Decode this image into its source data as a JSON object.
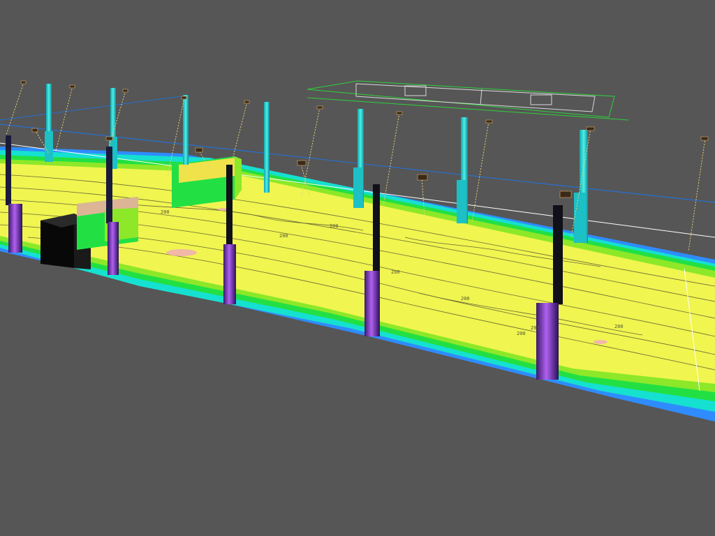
{
  "viewport": {
    "background": "#565656",
    "legend_palette": {
      "very_low": "#2f8cff",
      "low": "#16e0d0",
      "mid_low": "#22e044",
      "mid": "#8ce828",
      "high": "#f0f550",
      "very_high": "#ffd070",
      "peak": "#f2b1b1"
    }
  },
  "scene": {
    "type": "3d-illuminance-false-color-render",
    "field_contours": true,
    "grid_reference": true,
    "court_overlay": "wireframe",
    "unit_labels": [
      "200",
      "200",
      "200",
      "200",
      "200",
      "200",
      "200",
      "200"
    ]
  }
}
